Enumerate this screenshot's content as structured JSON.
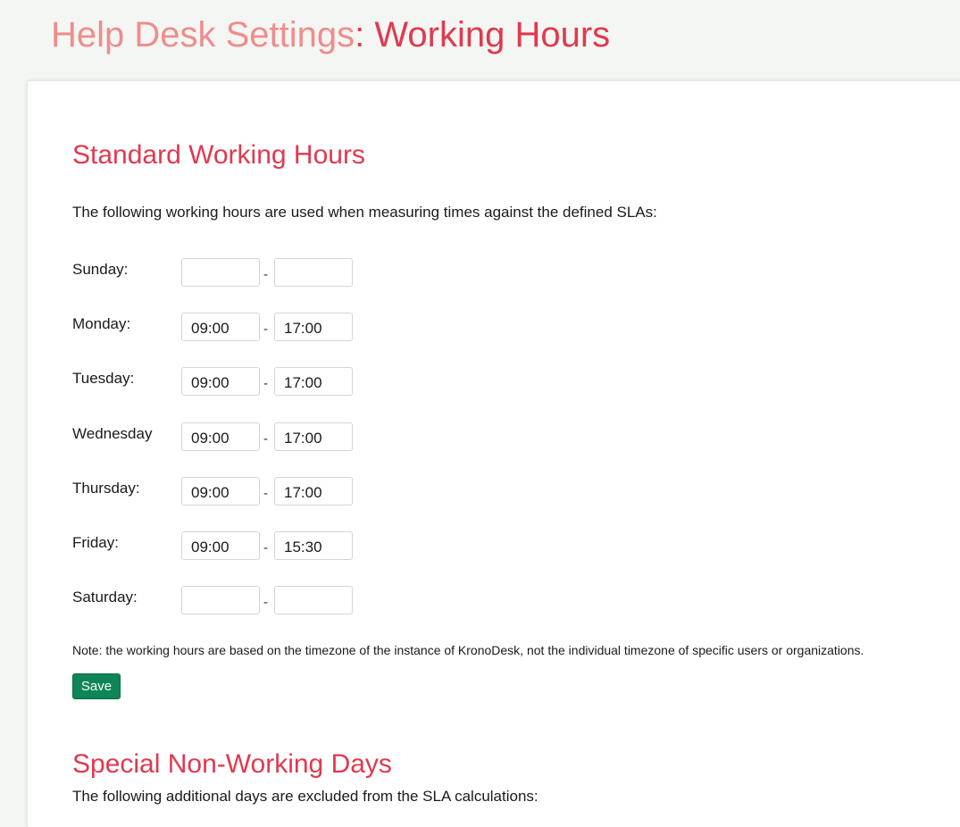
{
  "header": {
    "section": "Help Desk Settings",
    "separator": ":",
    "current": " Working Hours"
  },
  "standard": {
    "title": "Standard Working Hours",
    "description": "The following working hours are used when measuring times against the defined SLAs:",
    "dash": "-",
    "days": [
      {
        "label": "Sunday:",
        "start": "",
        "end": ""
      },
      {
        "label": "Monday:",
        "start": "09:00",
        "end": "17:00"
      },
      {
        "label": "Tuesday:",
        "start": "09:00",
        "end": "17:00"
      },
      {
        "label": "Wednesday",
        "start": "09:00",
        "end": "17:00"
      },
      {
        "label": "Thursday:",
        "start": "09:00",
        "end": "17:00"
      },
      {
        "label": "Friday:",
        "start": "09:00",
        "end": "15:30"
      },
      {
        "label": "Saturday:",
        "start": "",
        "end": ""
      }
    ],
    "note": "Note: the working hours are based on the timezone of the instance of KronoDesk, not the individual timezone of specific users or organizations.",
    "save_label": "Save"
  },
  "special": {
    "title": "Special Non-Working Days",
    "description": "The following additional days are excluded from the SLA calculations:"
  },
  "colors": {
    "accent": "#e0394f",
    "accent_light": "#ef8d8d",
    "save_button": "#0f8456"
  }
}
